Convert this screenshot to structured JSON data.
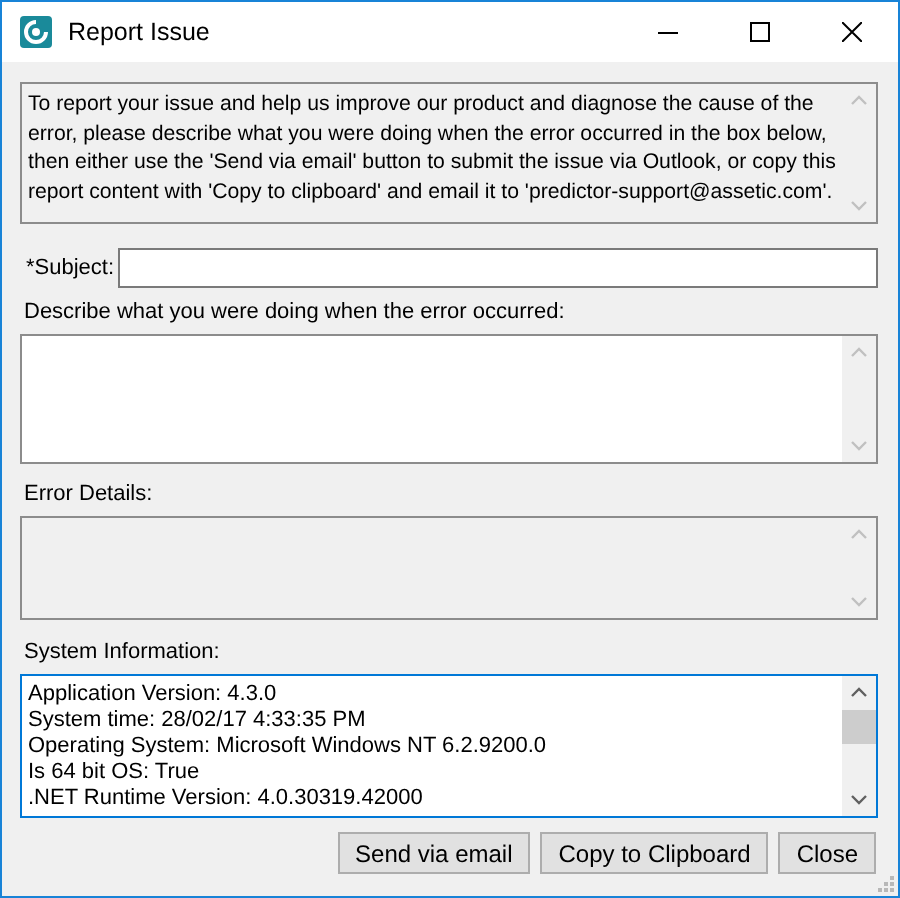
{
  "window": {
    "title": "Report Issue"
  },
  "intro": {
    "text": "To report your issue and help us improve our product and diagnose the cause of the error, please describe what you were doing when the error occurred in the box below, then either use the 'Send via email' button to submit the issue via Outlook, or copy this report content with 'Copy to clipboard' and email it to 'predictor-support@assetic.com'."
  },
  "subject": {
    "label": "*Subject:"
  },
  "description": {
    "label": "Describe what you were doing when the error occurred:"
  },
  "error_details": {
    "label": "Error Details:",
    "disabled": true
  },
  "system_information": {
    "label": "System Information:",
    "focused": true,
    "scrollable": true,
    "lines": [
      "Application Version: 4.3.0",
      "System time: 28/02/17 4:33:35 PM",
      "Operating System: Microsoft Windows NT 6.2.9200.0",
      "Is 64 bit OS: True",
      ".NET Runtime Version: 4.0.30319.42000"
    ]
  },
  "buttons": [
    "Send via email",
    "Copy to Clipboard",
    "Close"
  ]
}
